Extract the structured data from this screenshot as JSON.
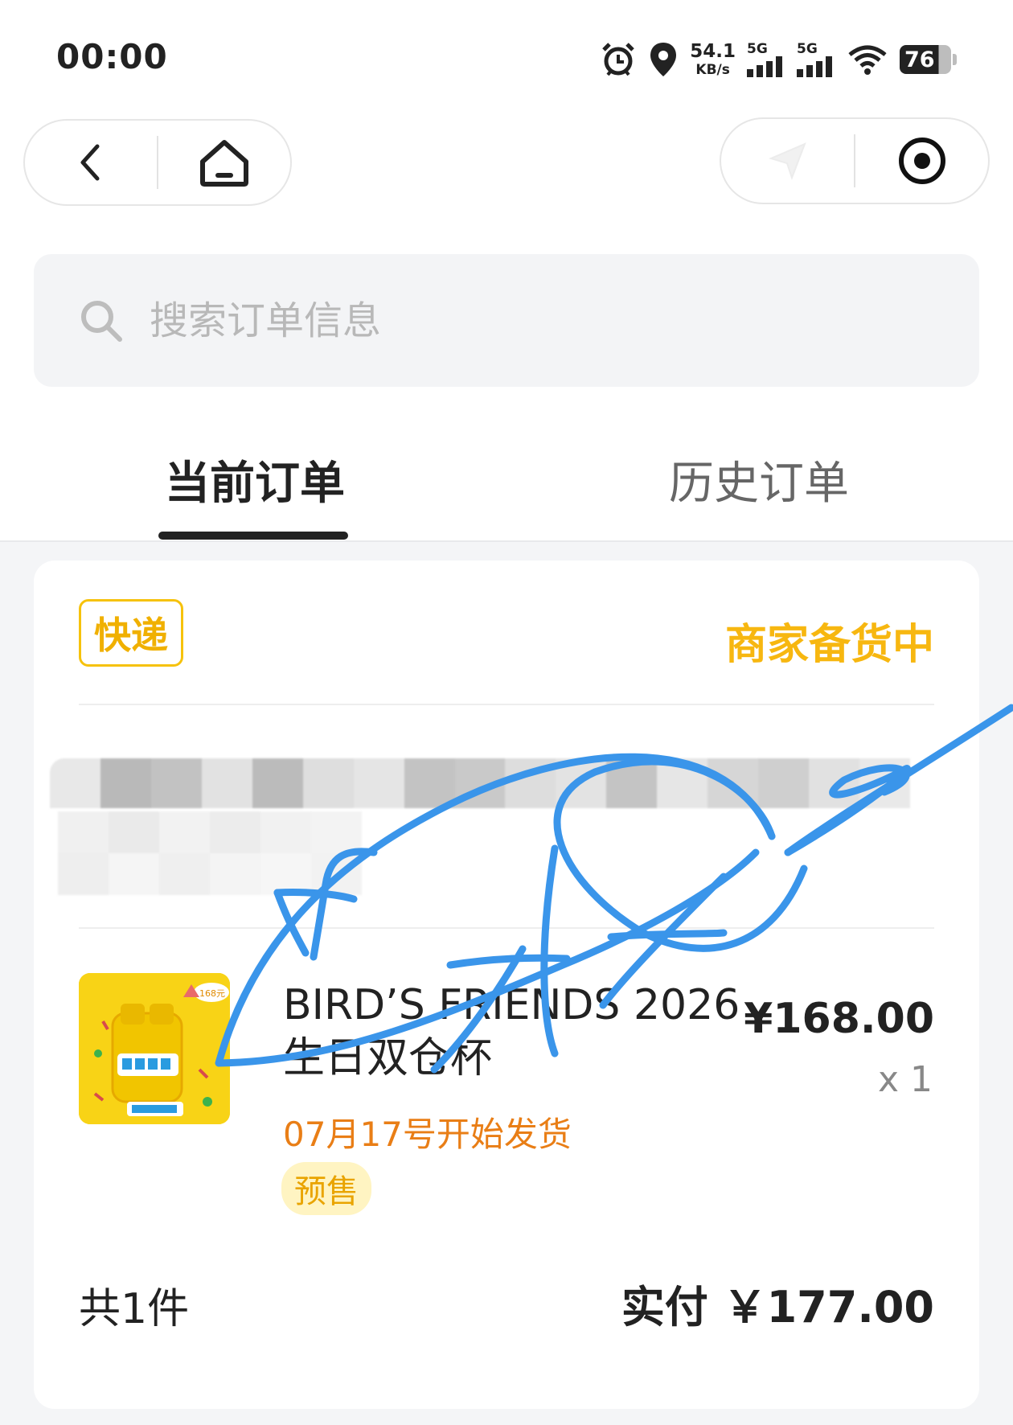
{
  "status_bar": {
    "time": "00:00",
    "speed_value": "54.1",
    "speed_unit": "KB/s",
    "sim1_label": "5G",
    "sim2_label": "5G",
    "battery": "76"
  },
  "nav": {
    "back_icon": "chevron-left-icon",
    "home_icon": "home-icon",
    "share_icon": "send-icon",
    "record_icon": "target-icon"
  },
  "search": {
    "placeholder": "搜索订单信息"
  },
  "tabs": {
    "current": "当前订单",
    "history": "历史订单",
    "active": "current"
  },
  "order": {
    "delivery_type": "快递",
    "status": "商家备货中",
    "product": {
      "title": "BIRD’S FRIENDS 2026 生日双仓杯",
      "price": "¥168.00",
      "quantity": "x 1",
      "ship_note": "07月17号开始发货",
      "tag": "预售",
      "image_label": "168元"
    },
    "count_text": "共1件",
    "paid_text": "实付 ￥177.00"
  },
  "colors": {
    "accent_yellow": "#f7b710",
    "ship_orange": "#e97e16",
    "scribble_blue": "#3a95ea"
  }
}
